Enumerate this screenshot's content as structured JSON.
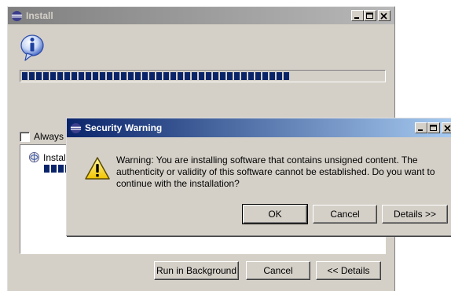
{
  "install_window": {
    "title": "Install",
    "progress_fraction": 0.74,
    "always_label": "Always",
    "job_label": "Instal",
    "buttons": {
      "run_in_background": "Run in Background",
      "cancel": "Cancel",
      "details": "<< Details"
    }
  },
  "security_dialog": {
    "title": "Security Warning",
    "message": "Warning: You are installing software that contains unsigned content. The authenticity or validity of this software cannot be established. Do you want to continue with the installation?",
    "buttons": {
      "ok": "OK",
      "cancel": "Cancel",
      "details": "Details >>"
    }
  },
  "icons": {
    "app": "eclipse-icon",
    "info": "info-icon",
    "warning": "warning-icon",
    "job": "install-job-icon"
  },
  "colors": {
    "active_title": "#0a246a",
    "inactive_title": "#808080",
    "face": "#d4d0c8",
    "progress": "#0a246a"
  }
}
